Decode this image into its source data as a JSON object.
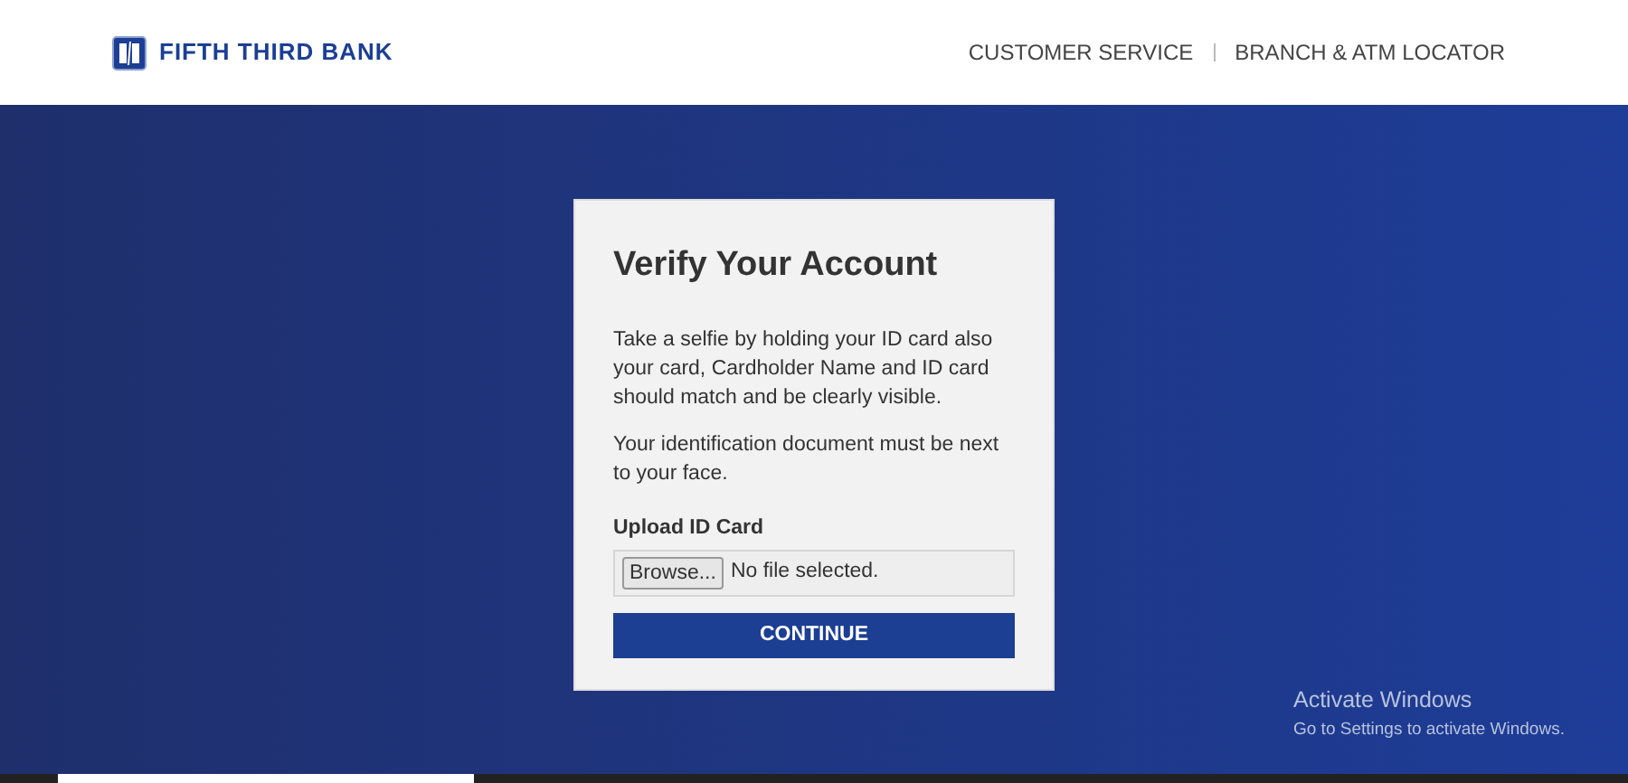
{
  "header": {
    "brand": "FIFTH THIRD BANK",
    "nav": [
      "CUSTOMER SERVICE",
      "BRANCH & ATM LOCATOR"
    ]
  },
  "card": {
    "title": "Verify Your Account",
    "paragraphs": [
      "Take a selfie by holding your ID card also your card, Cardholder Name and ID card should match and be clearly visible.",
      "Your identification document must be next to your face."
    ],
    "upload": {
      "label": "Upload ID Card",
      "button": "Browse...",
      "status": "No file selected."
    },
    "submit": "CONTINUE"
  },
  "os_notice": {
    "title": "Activate Windows",
    "text": "Go to Settings to activate Windows."
  }
}
